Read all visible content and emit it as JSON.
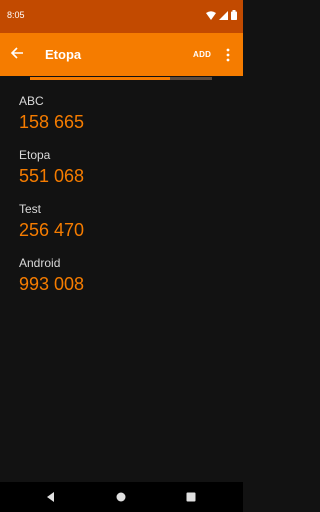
{
  "status": {
    "time": "8:05"
  },
  "app_bar": {
    "title": "Etopa",
    "add_label": "ADD"
  },
  "progress": {
    "fraction": 0.77
  },
  "entries": [
    {
      "name": "ABC",
      "code": "158 665"
    },
    {
      "name": "Etopa",
      "code": "551 068"
    },
    {
      "name": "Test",
      "code": "256 470"
    },
    {
      "name": "Android",
      "code": "993 008"
    }
  ],
  "colors": {
    "status_bar": "#c24a00",
    "app_bar": "#f57c00",
    "accent": "#f57c00",
    "background": "#121212"
  },
  "icons": {
    "back": "arrow-back-icon",
    "more": "more-vert-icon",
    "wifi": "wifi-icon",
    "signal": "signal-icon",
    "battery": "battery-icon",
    "nav_back": "nav-back-icon",
    "nav_home": "nav-home-icon",
    "nav_recents": "nav-recents-icon"
  }
}
